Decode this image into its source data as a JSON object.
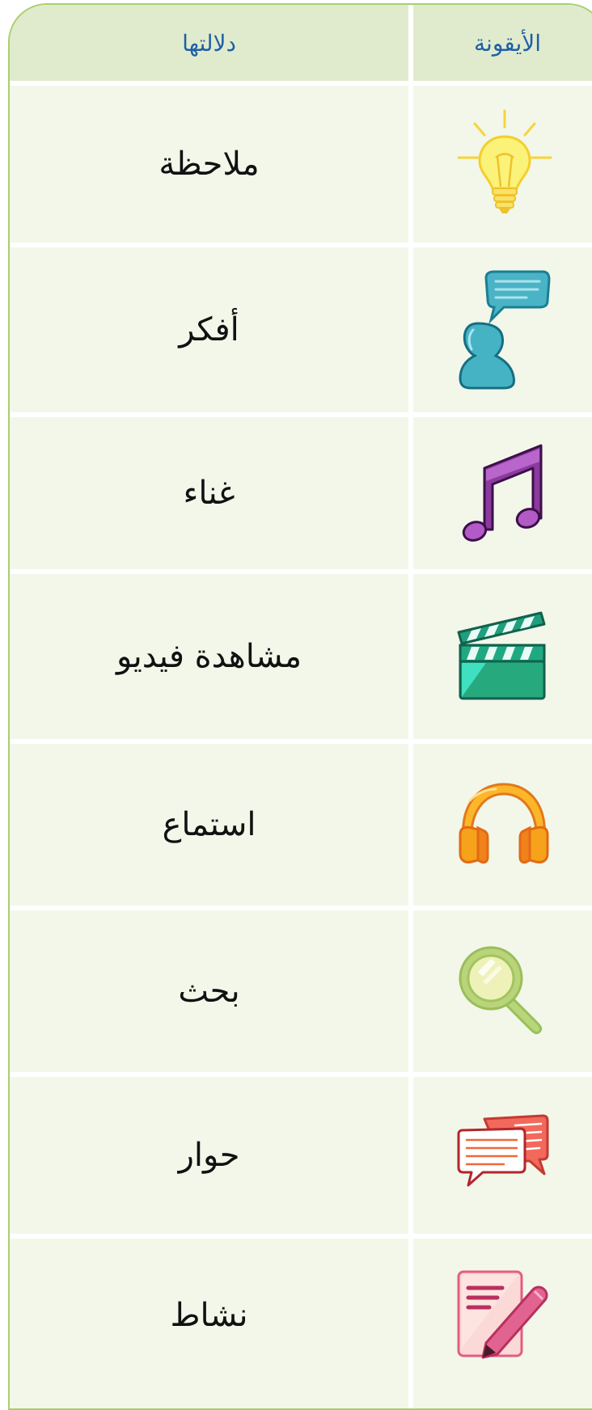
{
  "table": {
    "headers": {
      "icon": "الأيقونة",
      "meaning": "دلالتها"
    },
    "rows": [
      {
        "icon": "lightbulb-icon",
        "meaning": "ملاحظة"
      },
      {
        "icon": "person-speech-bubble-icon",
        "meaning": "أفكر"
      },
      {
        "icon": "music-note-icon",
        "meaning": "غناء"
      },
      {
        "icon": "clapperboard-icon",
        "meaning": "مشاهدة فيديو"
      },
      {
        "icon": "headphones-icon",
        "meaning": "استماع"
      },
      {
        "icon": "magnifier-icon",
        "meaning": "بحث"
      },
      {
        "icon": "chat-bubbles-icon",
        "meaning": "حوار"
      },
      {
        "icon": "pencil-note-icon",
        "meaning": "نشاط"
      }
    ]
  },
  "colors": {
    "header_bg": "#e0ebcd",
    "row_bg": "#f2f7ea",
    "border": "#a9cf6d",
    "header_text": "#1f5fa6"
  }
}
